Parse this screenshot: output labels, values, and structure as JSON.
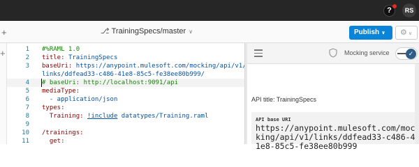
{
  "topbar": {
    "help_label": "?",
    "avatar_initials": "RS"
  },
  "toolbar": {
    "branch_label": "TrainingSpecs/master",
    "publish_label": "Publish",
    "left_icon": "+",
    "colors": {
      "publish_bg": "#0a84d8"
    }
  },
  "editor": {
    "lines": [
      {
        "num": "1",
        "tokens": [
          {
            "text": "#%RAML 1.0",
            "kind": "comment"
          }
        ]
      },
      {
        "num": "2",
        "tokens": [
          {
            "text": "title: ",
            "kind": "key"
          },
          {
            "text": "TrainingSpecs",
            "kind": "str"
          }
        ]
      },
      {
        "num": "3",
        "tokens": [
          {
            "text": "baseUri: ",
            "kind": "key"
          },
          {
            "text": "https://anypoint.mulesoft.com/mocking/api/v1/",
            "kind": "str"
          }
        ]
      },
      {
        "num": "",
        "tokens": [
          {
            "text": "links/ddfead33-c486-41e8-85c5-fe38ee80b999/",
            "kind": "str"
          }
        ]
      },
      {
        "num": "4",
        "tokens": [
          {
            "text": "# baseUri: http://localhost:9091/api",
            "kind": "comment"
          }
        ]
      },
      {
        "num": "5",
        "tokens": [
          {
            "text": "mediaType:",
            "kind": "key"
          }
        ]
      },
      {
        "num": "6",
        "tokens": [
          {
            "text": "  - application/json",
            "kind": "str"
          }
        ]
      },
      {
        "num": "7",
        "tokens": [
          {
            "text": "types:",
            "kind": "key"
          }
        ]
      },
      {
        "num": "8",
        "tokens": [
          {
            "text": "  Training: ",
            "kind": "key"
          },
          {
            "text": "!include",
            "kind": "tag"
          },
          {
            "text": " datatypes/Training.raml",
            "kind": "str"
          }
        ]
      },
      {
        "num": "9",
        "tokens": [
          {
            "text": "",
            "kind": "plain"
          }
        ]
      },
      {
        "num": "10",
        "tokens": [
          {
            "text": "/trainings:",
            "kind": "key"
          }
        ]
      },
      {
        "num": "11",
        "tokens": [
          {
            "text": "  get:",
            "kind": "key"
          }
        ]
      }
    ]
  },
  "right_panel": {
    "mocking_label": "Mocking service",
    "mocking_enabled": true,
    "api_title_text": "API title: TrainingSpecs",
    "base_uri_label": "API base URI",
    "base_uri_value": "https://anypoint.mulesoft.com/mocking/api/v1/links/ddfead33-c486-41e8-85c5-fe38ee80b999"
  }
}
